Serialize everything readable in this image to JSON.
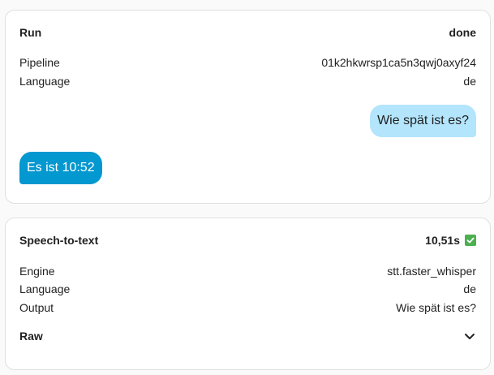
{
  "run": {
    "title": "Run",
    "status": "done",
    "pipeline_label": "Pipeline",
    "pipeline_value": "01k2hkwrsp1ca5n3qwj0axyf24",
    "language_label": "Language",
    "language_value": "de",
    "user_message": "Wie spät ist es?",
    "agent_message": "Es ist 10:52"
  },
  "stt": {
    "title": "Speech-to-text",
    "duration": "10,51s",
    "status_icon": "check-icon",
    "engine_label": "Engine",
    "engine_value": "stt.faster_whisper",
    "language_label": "Language",
    "language_value": "de",
    "output_label": "Output",
    "output_value": "Wie spät ist es?",
    "raw_label": "Raw",
    "raw_icon": "chevron-down-icon"
  },
  "colors": {
    "user_bubble": "#b3e5fc",
    "agent_bubble": "#0398d0",
    "success": "#4caf50"
  }
}
